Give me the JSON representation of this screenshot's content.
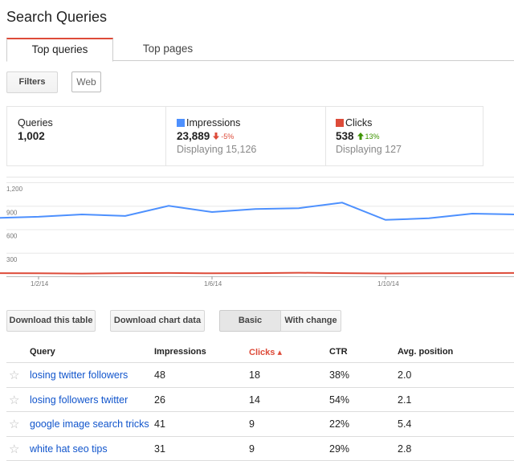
{
  "page": {
    "title": "Search Queries"
  },
  "tabs": [
    {
      "label": "Top queries",
      "active": true
    },
    {
      "label": "Top pages",
      "active": false
    }
  ],
  "filters": {
    "button_label": "Filters",
    "chip_label": "Web"
  },
  "stats": {
    "queries": {
      "label": "Queries",
      "value": "1,002"
    },
    "impressions": {
      "label": "Impressions",
      "value": "23,889",
      "delta": "-5%",
      "delta_direction": "down",
      "sub": "Displaying 15,126",
      "color": "#4d90fe"
    },
    "clicks": {
      "label": "Clicks",
      "value": "538",
      "delta": "13%",
      "delta_direction": "up",
      "sub": "Displaying 127",
      "color": "#dd4b39"
    }
  },
  "chart_data": {
    "type": "line",
    "x": [
      "1/1/14",
      "1/2/14",
      "1/3/14",
      "1/4/14",
      "1/5/14",
      "1/6/14",
      "1/7/14",
      "1/8/14",
      "1/9/14",
      "1/10/14",
      "1/11/14",
      "1/12/14",
      "1/13/14"
    ],
    "x_tick_labels": [
      "1/2/14",
      "1/6/14",
      "1/10/14"
    ],
    "y_tick_labels": [
      "1,200",
      "900",
      "600",
      "300"
    ],
    "ylim": [
      0,
      1200
    ],
    "grid": true,
    "series": [
      {
        "name": "Impressions",
        "color": "#4d90fe",
        "values": [
          745,
          760,
          790,
          770,
          900,
          820,
          860,
          870,
          940,
          720,
          740,
          800,
          790
        ]
      },
      {
        "name": "Clicks",
        "color": "#dd4b39",
        "values": [
          40,
          38,
          35,
          40,
          42,
          38,
          40,
          45,
          40,
          36,
          38,
          40,
          42
        ]
      }
    ]
  },
  "actions": {
    "download_table": "Download this table",
    "download_chart": "Download chart data",
    "basic": "Basic",
    "with_change": "With change"
  },
  "table": {
    "headers": {
      "query": "Query",
      "impressions": "Impressions",
      "clicks": "Clicks ▴",
      "ctr": "CTR",
      "avg_position": "Avg. position"
    },
    "rows": [
      {
        "query": "losing twitter followers",
        "impressions": "48",
        "clicks": "18",
        "ctr": "38%",
        "avg_position": "2.0"
      },
      {
        "query": "losing followers twitter",
        "impressions": "26",
        "clicks": "14",
        "ctr": "54%",
        "avg_position": "2.1"
      },
      {
        "query": "google image search tricks",
        "impressions": "41",
        "clicks": "9",
        "ctr": "22%",
        "avg_position": "5.4"
      },
      {
        "query": "white hat seo tips",
        "impressions": "31",
        "clicks": "9",
        "ctr": "29%",
        "avg_position": "2.8"
      }
    ]
  }
}
